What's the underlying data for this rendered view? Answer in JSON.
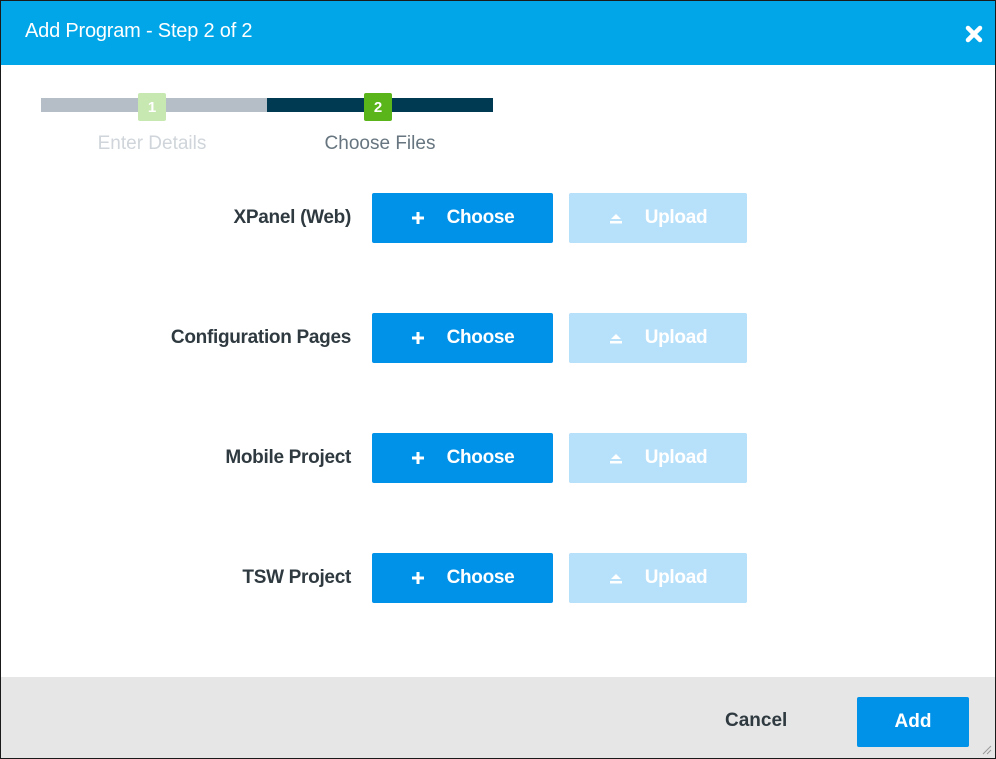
{
  "dialog": {
    "title": "Add Program - Step 2 of 2",
    "close_icon": "close-icon",
    "colors": {
      "header": "#00a6e8",
      "primary_button": "#0091e8",
      "disabled_button": "#b7e0fa",
      "footer": "#e6e6e6"
    }
  },
  "stepper": {
    "steps": [
      {
        "number": "1",
        "label": "Enter Details",
        "state": "completed"
      },
      {
        "number": "2",
        "label": "Choose Files",
        "state": "active"
      }
    ]
  },
  "rows": [
    {
      "label": "XPanel (Web)",
      "choose_label": "Choose",
      "upload_label": "Upload"
    },
    {
      "label": "Configuration Pages",
      "choose_label": "Choose",
      "upload_label": "Upload"
    },
    {
      "label": "Mobile Project",
      "choose_label": "Choose",
      "upload_label": "Upload"
    },
    {
      "label": "TSW Project",
      "choose_label": "Choose",
      "upload_label": "Upload"
    }
  ],
  "footer": {
    "cancel_label": "Cancel",
    "add_label": "Add"
  }
}
